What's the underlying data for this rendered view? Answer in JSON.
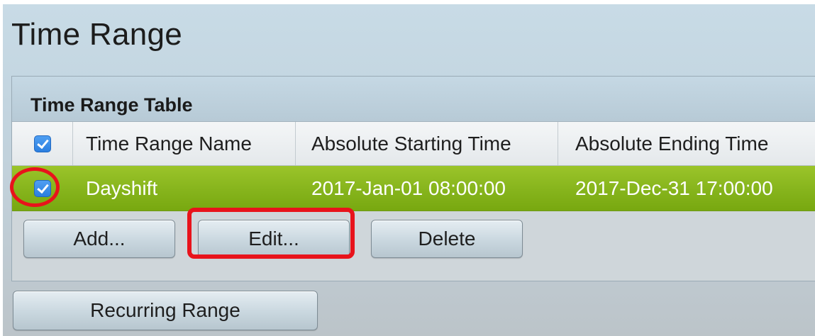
{
  "page": {
    "title": "Time Range"
  },
  "table": {
    "title": "Time Range Table",
    "columns": [
      "Time Range Name",
      "Absolute Starting Time",
      "Absolute Ending Time"
    ],
    "rows": [
      {
        "selected": true,
        "name": "Dayshift",
        "start": "2017-Jan-01 08:00:00",
        "end": "2017-Dec-31 17:00:00"
      }
    ]
  },
  "buttons": {
    "add": "Add...",
    "edit": "Edit...",
    "delete": "Delete",
    "recurring": "Recurring Range"
  },
  "colors": {
    "selected_row": "#86b41c",
    "highlight": "#e8131b",
    "checkbox": "#2b7fe0"
  }
}
